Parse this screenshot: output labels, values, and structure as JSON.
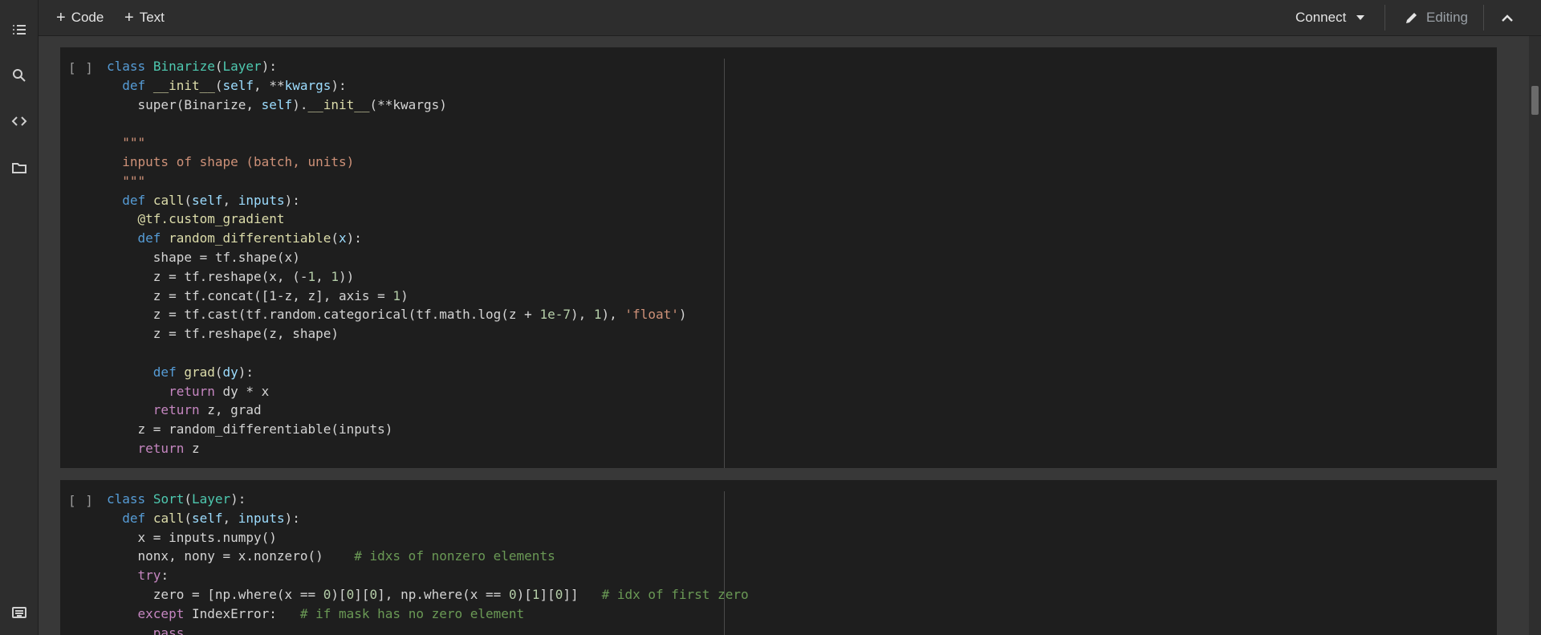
{
  "toolbar": {
    "add_code_label": "Code",
    "add_text_label": "Text",
    "connect_label": "Connect",
    "editing_label": "Editing"
  },
  "sidebar": {
    "items": [
      {
        "icon": "table-of-contents-icon"
      },
      {
        "icon": "search-icon"
      },
      {
        "icon": "code-snippets-icon"
      },
      {
        "icon": "folder-icon"
      },
      {
        "icon": "terminal-icon"
      }
    ]
  },
  "cells": [
    {
      "bracket": "[ ]",
      "lines": [
        [
          {
            "t": "class",
            "c": "kw"
          },
          {
            "t": " "
          },
          {
            "t": "Binarize",
            "c": "cls"
          },
          {
            "t": "("
          },
          {
            "t": "Layer",
            "c": "cls"
          },
          {
            "t": "):"
          }
        ],
        [
          {
            "t": "  "
          },
          {
            "t": "def",
            "c": "kw"
          },
          {
            "t": " "
          },
          {
            "t": "__init__",
            "c": "fn"
          },
          {
            "t": "("
          },
          {
            "t": "self",
            "c": "prm"
          },
          {
            "t": ", **"
          },
          {
            "t": "kwargs",
            "c": "prm"
          },
          {
            "t": "):"
          }
        ],
        [
          {
            "t": "    super(Binarize, "
          },
          {
            "t": "self",
            "c": "prm"
          },
          {
            "t": ")."
          },
          {
            "t": "__init__",
            "c": "fn"
          },
          {
            "t": "(**kwargs)"
          }
        ],
        [
          {
            "t": ""
          }
        ],
        [
          {
            "t": "  "
          },
          {
            "t": "\"\"\"",
            "c": "str"
          }
        ],
        [
          {
            "t": "  "
          },
          {
            "t": "inputs of shape (batch, units)",
            "c": "str"
          }
        ],
        [
          {
            "t": "  "
          },
          {
            "t": "\"\"\"",
            "c": "str"
          }
        ],
        [
          {
            "t": "  "
          },
          {
            "t": "def",
            "c": "kw"
          },
          {
            "t": " "
          },
          {
            "t": "call",
            "c": "fn"
          },
          {
            "t": "("
          },
          {
            "t": "self",
            "c": "prm"
          },
          {
            "t": ", "
          },
          {
            "t": "inputs",
            "c": "prm"
          },
          {
            "t": "):"
          }
        ],
        [
          {
            "t": "    "
          },
          {
            "t": "@tf.custom_gradient",
            "c": "dec"
          }
        ],
        [
          {
            "t": "    "
          },
          {
            "t": "def",
            "c": "kw"
          },
          {
            "t": " "
          },
          {
            "t": "random_differentiable",
            "c": "fn"
          },
          {
            "t": "("
          },
          {
            "t": "x",
            "c": "prm"
          },
          {
            "t": "):"
          }
        ],
        [
          {
            "t": "      shape = tf.shape(x)"
          }
        ],
        [
          {
            "t": "      z = tf.reshape(x, (-"
          },
          {
            "t": "1",
            "c": "num"
          },
          {
            "t": ", "
          },
          {
            "t": "1",
            "c": "num"
          },
          {
            "t": "))"
          }
        ],
        [
          {
            "t": "      z = tf.concat([1-z, z], axis = "
          },
          {
            "t": "1",
            "c": "num"
          },
          {
            "t": ")"
          }
        ],
        [
          {
            "t": "      z = tf.cast(tf.random.categorical(tf.math.log(z + "
          },
          {
            "t": "1e-7",
            "c": "num"
          },
          {
            "t": "), "
          },
          {
            "t": "1",
            "c": "num"
          },
          {
            "t": "), "
          },
          {
            "t": "'float'",
            "c": "str"
          },
          {
            "t": ")"
          }
        ],
        [
          {
            "t": "      z = tf.reshape(z, shape)"
          }
        ],
        [
          {
            "t": ""
          }
        ],
        [
          {
            "t": "      "
          },
          {
            "t": "def",
            "c": "kw"
          },
          {
            "t": " "
          },
          {
            "t": "grad",
            "c": "fn"
          },
          {
            "t": "("
          },
          {
            "t": "dy",
            "c": "prm"
          },
          {
            "t": "):"
          }
        ],
        [
          {
            "t": "        "
          },
          {
            "t": "return",
            "c": "ctl"
          },
          {
            "t": " dy * x"
          }
        ],
        [
          {
            "t": "      "
          },
          {
            "t": "return",
            "c": "ctl"
          },
          {
            "t": " z, grad"
          }
        ],
        [
          {
            "t": "    z = random_differentiable(inputs)"
          }
        ],
        [
          {
            "t": "    "
          },
          {
            "t": "return",
            "c": "ctl"
          },
          {
            "t": " z"
          }
        ]
      ]
    },
    {
      "bracket": "[ ]",
      "lines": [
        [
          {
            "t": "class",
            "c": "kw"
          },
          {
            "t": " "
          },
          {
            "t": "Sort",
            "c": "cls"
          },
          {
            "t": "("
          },
          {
            "t": "Layer",
            "c": "cls"
          },
          {
            "t": "):"
          }
        ],
        [
          {
            "t": "  "
          },
          {
            "t": "def",
            "c": "kw"
          },
          {
            "t": " "
          },
          {
            "t": "call",
            "c": "fn"
          },
          {
            "t": "("
          },
          {
            "t": "self",
            "c": "prm"
          },
          {
            "t": ", "
          },
          {
            "t": "inputs",
            "c": "prm"
          },
          {
            "t": "):"
          }
        ],
        [
          {
            "t": "    x = inputs.numpy()"
          }
        ],
        [
          {
            "t": "    nonx, nony = x.nonzero()    "
          },
          {
            "t": "# idxs of nonzero elements",
            "c": "cmt"
          }
        ],
        [
          {
            "t": "    "
          },
          {
            "t": "try",
            "c": "ctl"
          },
          {
            "t": ":"
          }
        ],
        [
          {
            "t": "      zero = [np.where(x == "
          },
          {
            "t": "0",
            "c": "num"
          },
          {
            "t": ")["
          },
          {
            "t": "0",
            "c": "num"
          },
          {
            "t": "]["
          },
          {
            "t": "0",
            "c": "num"
          },
          {
            "t": "], np.where(x == "
          },
          {
            "t": "0",
            "c": "num"
          },
          {
            "t": ")["
          },
          {
            "t": "1",
            "c": "num"
          },
          {
            "t": "]["
          },
          {
            "t": "0",
            "c": "num"
          },
          {
            "t": "]]   "
          },
          {
            "t": "# idx of first zero",
            "c": "cmt"
          }
        ],
        [
          {
            "t": "    "
          },
          {
            "t": "except",
            "c": "ctl"
          },
          {
            "t": " IndexError:   "
          },
          {
            "t": "# if mask has no zero element",
            "c": "cmt"
          }
        ],
        [
          {
            "t": "      "
          },
          {
            "t": "pass",
            "c": "ctl"
          }
        ]
      ]
    }
  ]
}
